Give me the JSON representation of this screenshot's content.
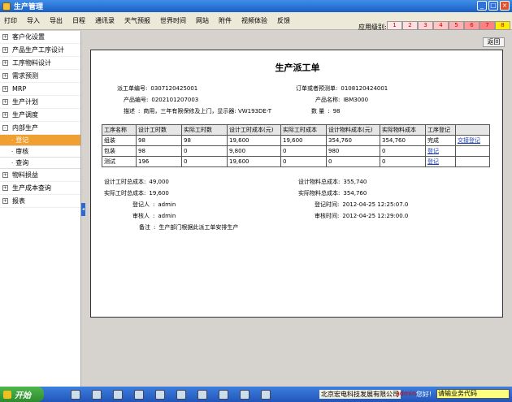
{
  "window": {
    "title": "生产管理"
  },
  "menu": [
    "打印",
    "导入",
    "导出",
    "日程",
    "通讯录",
    "天气预报",
    "世界时间",
    "网站",
    "附件",
    "视频体验",
    "反馈"
  ],
  "level": {
    "label": "应用级别:",
    "values": [
      "1",
      "2",
      "3",
      "4",
      "5",
      "6",
      "7",
      "8"
    ],
    "colors": [
      "#ffe8e8",
      "#ffe0e0",
      "#ffd4d4",
      "#ffc4c4",
      "#ffb0b0",
      "#ff9a9a",
      "#ff8080",
      "#ffee00"
    ]
  },
  "sidebar": {
    "items": [
      {
        "label": "客户化设置",
        "expander": "+"
      },
      {
        "label": "产品生产工序设计",
        "expander": "+"
      },
      {
        "label": "工序物料设计",
        "expander": "+"
      },
      {
        "label": "需求预测",
        "expander": "+"
      },
      {
        "label": "MRP",
        "expander": "+"
      },
      {
        "label": "生产计划",
        "expander": "+"
      },
      {
        "label": "生产调度",
        "expander": "+"
      },
      {
        "label": "内部生产",
        "expander": "-"
      }
    ],
    "sub_items": [
      "登记",
      "审核",
      "查询"
    ],
    "items_after": [
      {
        "label": "物料损益",
        "expander": "+"
      },
      {
        "label": "生产成本查询",
        "expander": "+"
      },
      {
        "label": "报表",
        "expander": "+"
      }
    ]
  },
  "main": {
    "return_button": "返回",
    "doc_title": "生产派工单",
    "fields": {
      "order_no_label": "派工单编号:",
      "order_no": "0307120425001",
      "forecast_label": "订单或者预测单:",
      "forecast": "0108120424001",
      "product_code_label": "产品编号:",
      "product_code": "0202101207003",
      "product_name_label": "产品名称:",
      "product_name": "IBM3000",
      "desc_label": "描述",
      "desc": "商用，三年有限保修及上门，显示器: VW193DE-T",
      "qty_label": "数 量",
      "qty": "98"
    },
    "table": {
      "headers": [
        "工序名称",
        "设计工时数",
        "实际工时数",
        "设计工时成本(元)",
        "实际工时成本",
        "设计物料成本(元)",
        "实际物料成本",
        "工序登记",
        ""
      ],
      "rows": [
        [
          "组装",
          "98",
          "98",
          "19,600",
          "19,600",
          "354,760",
          "354,760",
          "完成",
          "交接登记"
        ],
        [
          "包装",
          "98",
          "0",
          "9,800",
          "0",
          "980",
          "0",
          "登记",
          ""
        ],
        [
          "测试",
          "196",
          "0",
          "19,600",
          "0",
          "0",
          "0",
          "登记",
          ""
        ]
      ]
    },
    "summary": {
      "design_hours_cost_label": "设计工时总成本:",
      "design_hours_cost": "49,000",
      "actual_hours_cost_label": "实际工时总成本:",
      "actual_hours_cost": "19,600",
      "registrar_label": "登记人",
      "registrar": "admin",
      "reviewer_label": "审核人",
      "reviewer": "admin",
      "note_label": "备注",
      "note": "生产部门根据此派工单安排生产",
      "design_material_cost_label": "设计物料总成本:",
      "design_material_cost": "355,740",
      "actual_material_cost_label": "实际物料总成本:",
      "actual_material_cost": "354,760",
      "register_time_label": "登记时间:",
      "register_time": "2012-04-25 12:25:07.0",
      "review_time_label": "审核时间:",
      "review_time": "2012-04-25 12:29:00.0"
    }
  },
  "statusbar": {
    "start_label": "开始",
    "company": "北京宏电科技发展有限公司",
    "user": "admin",
    "hello": "您好!",
    "biz_code_placeholder": "请输业务代码"
  }
}
